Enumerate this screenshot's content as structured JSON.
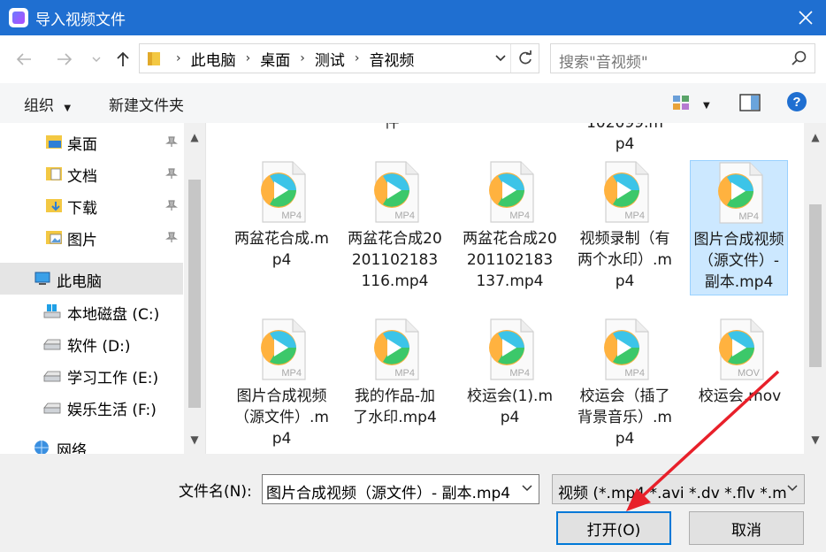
{
  "window": {
    "title": "导入视频文件"
  },
  "address": {
    "breadcrumbs": [
      "此电脑",
      "桌面",
      "测试",
      "音视频"
    ]
  },
  "search": {
    "placeholder": "搜索\"音视频\""
  },
  "toolbar": {
    "organize_label": "组织",
    "new_folder_label": "新建文件夹"
  },
  "nav": {
    "items": [
      {
        "label": "桌面",
        "icon": "desktop-folder-icon",
        "pinned": true
      },
      {
        "label": "文档",
        "icon": "documents-folder-icon",
        "pinned": true
      },
      {
        "label": "下载",
        "icon": "downloads-folder-icon",
        "pinned": true
      },
      {
        "label": "图片",
        "icon": "pictures-folder-icon",
        "pinned": true
      },
      {
        "label": "此电脑",
        "icon": "this-pc-icon",
        "selected": true
      },
      {
        "label": "本地磁盘 (C:)",
        "icon": "windows-drive-icon"
      },
      {
        "label": "软件 (D:)",
        "icon": "drive-icon"
      },
      {
        "label": "学习工作 (E:)",
        "icon": "drive-icon"
      },
      {
        "label": "娱乐生活 (F:)",
        "icon": "drive-icon"
      },
      {
        "label": "网络",
        "icon": "network-icon"
      }
    ]
  },
  "files": {
    "partial_top": [
      "件",
      "102099.m\np4"
    ],
    "items": [
      {
        "name": "两盆花合成.mp4",
        "ext": "MP4"
      },
      {
        "name": "两盆花合成20201102183116.mp4",
        "ext": "MP4"
      },
      {
        "name": "两盆花合成20201102183137.mp4",
        "ext": "MP4"
      },
      {
        "name": "视频录制（有两个水印）.mp4",
        "ext": "MP4"
      },
      {
        "name": "图片合成视频（源文件）- 副本.mp4",
        "ext": "MP4",
        "selected": true
      },
      {
        "name": "图片合成视频（源文件）.mp4",
        "ext": "MP4"
      },
      {
        "name": "我的作品-加了水印.mp4",
        "ext": "MP4"
      },
      {
        "name": "校运会(1).mp4",
        "ext": "MP4"
      },
      {
        "name": "校运会（插了背景音乐）.mp4",
        "ext": "MP4"
      },
      {
        "name": "校运会.mov",
        "ext": "MOV"
      }
    ]
  },
  "bottom": {
    "filename_label": "文件名(N):",
    "filename_value": "图片合成视频（源文件）- 副本.mp4",
    "filetype_value": "视频 (*.mp4 *.avi *.dv *.flv *.m",
    "open_label": "打开(O)",
    "cancel_label": "取消"
  },
  "colors": {
    "titlebar": "#1f6fd1",
    "selection": "#cce8ff",
    "accent_arrow": "#e8202a"
  }
}
